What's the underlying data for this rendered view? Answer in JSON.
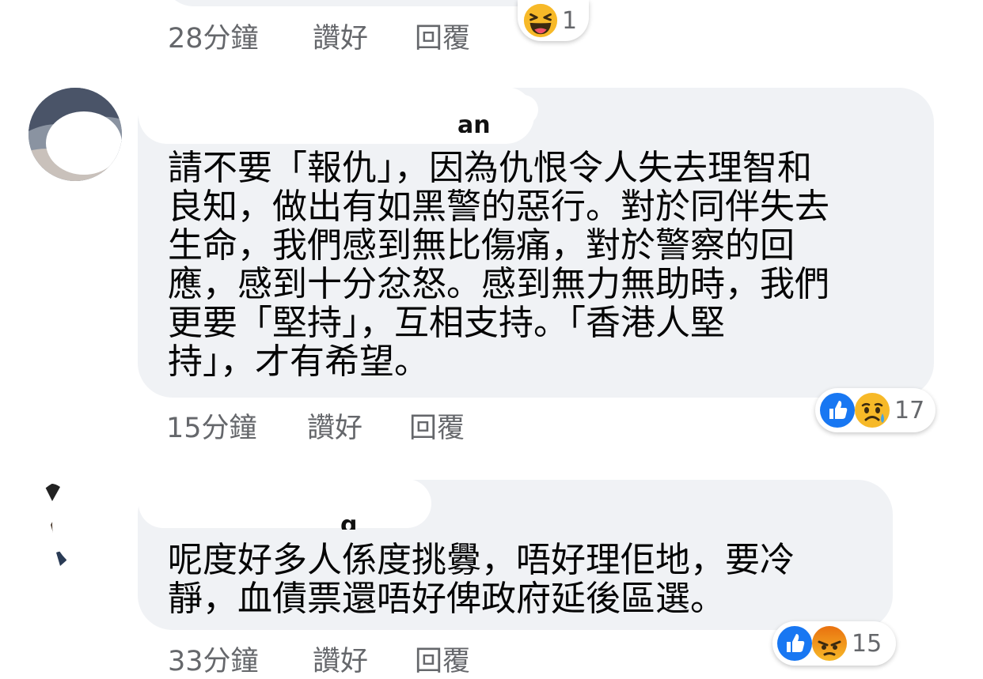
{
  "comments": [
    {
      "time": "28分鐘",
      "like": "讚好",
      "reply": "回覆",
      "reaction": {
        "count": "1",
        "icons": [
          "haha-icon"
        ]
      }
    },
    {
      "author_visible": "an",
      "text": "請不要「報仇」，因為仇恨令人失去理智和\n良知，做出有如黑警的惡行。對於同伴失去\n生命，我們感到無比傷痛，對於警察的回\n應，感到十分忿怒。感到無力無助時，我們\n更要「堅持」，互相支持。「香港人堅\n持」，才有希望。",
      "time": "15分鐘",
      "like": "讚好",
      "reply": "回覆",
      "reaction": {
        "count": "17",
        "icons": [
          "like-icon",
          "sad-icon"
        ]
      }
    },
    {
      "author_visible": "g",
      "text": "呢度好多人係度挑釁，唔好理佢地，要冷\n靜，血債票還唔好俾政府延後區選。",
      "time": "33分鐘",
      "like": "讚好",
      "reply": "回覆",
      "reaction": {
        "count": "15",
        "icons": [
          "like-icon",
          "angry-icon"
        ]
      }
    }
  ],
  "colors": {
    "bubble": "#f0f2f5",
    "meta_text": "#65676b",
    "like_blue": "#1877f2",
    "haha_yellow": "#f7b928",
    "angry_orange": "#e9710f"
  }
}
